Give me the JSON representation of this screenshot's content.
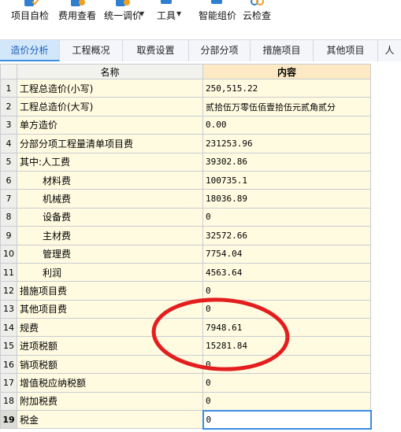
{
  "toolbar": {
    "items": [
      {
        "label": "项目自检",
        "icon": "check-icon"
      },
      {
        "label": "费用查看",
        "icon": "fee-view-icon"
      },
      {
        "label": "统一调价",
        "icon": "adjust-price-icon"
      },
      {
        "label": "工具",
        "icon": "tools-icon"
      },
      {
        "label": "智能组价",
        "icon": "smart-price-icon"
      },
      {
        "label": "云检查",
        "icon": "cloud-check-icon"
      }
    ]
  },
  "tabs": [
    "造价分析",
    "工程概况",
    "取费设置",
    "分部分项",
    "措施项目",
    "其他项目",
    "人"
  ],
  "active_tab": "造价分析",
  "grid": {
    "headers": {
      "name": "名称",
      "content": "内容"
    },
    "rows": [
      {
        "num": "1",
        "name": "工程总造价(小写)",
        "value": "250,515.22"
      },
      {
        "num": "2",
        "name": "工程总造价(大写)",
        "value": "贰拾伍万零伍佰壹拾伍元贰角贰分"
      },
      {
        "num": "3",
        "name": "单方造价",
        "value": "0.00"
      },
      {
        "num": "4",
        "name": "分部分项工程量清单项目费",
        "value": "231253.96"
      },
      {
        "num": "5",
        "name": "其中:人工费",
        "value": "39302.86"
      },
      {
        "num": "6",
        "name": "材料费",
        "value": "100735.1"
      },
      {
        "num": "7",
        "name": "机械费",
        "value": "18036.89"
      },
      {
        "num": "8",
        "name": "设备费",
        "value": "0"
      },
      {
        "num": "9",
        "name": "主材费",
        "value": "32572.66"
      },
      {
        "num": "10",
        "name": "管理费",
        "value": "7754.04"
      },
      {
        "num": "11",
        "name": "利润",
        "value": "4563.64"
      },
      {
        "num": "12",
        "name": "措施项目费",
        "value": "0"
      },
      {
        "num": "13",
        "name": "其他项目费",
        "value": "0"
      },
      {
        "num": "14",
        "name": "规费",
        "value": "7948.61"
      },
      {
        "num": "15",
        "name": "进项税额",
        "value": "15281.84"
      },
      {
        "num": "16",
        "name": "销项税额",
        "value": "0"
      },
      {
        "num": "17",
        "name": "增值税应纳税额",
        "value": "0"
      },
      {
        "num": "18",
        "name": "附加税费",
        "value": "0"
      },
      {
        "num": "19",
        "name": "税金",
        "value": "0"
      }
    ],
    "selected_row": "19"
  },
  "colors": {
    "accent": "#3d8ee0",
    "cell_bg": "#fffbe1",
    "header_content_bg": "#fde9c4",
    "annotation": "#e41e1e"
  }
}
